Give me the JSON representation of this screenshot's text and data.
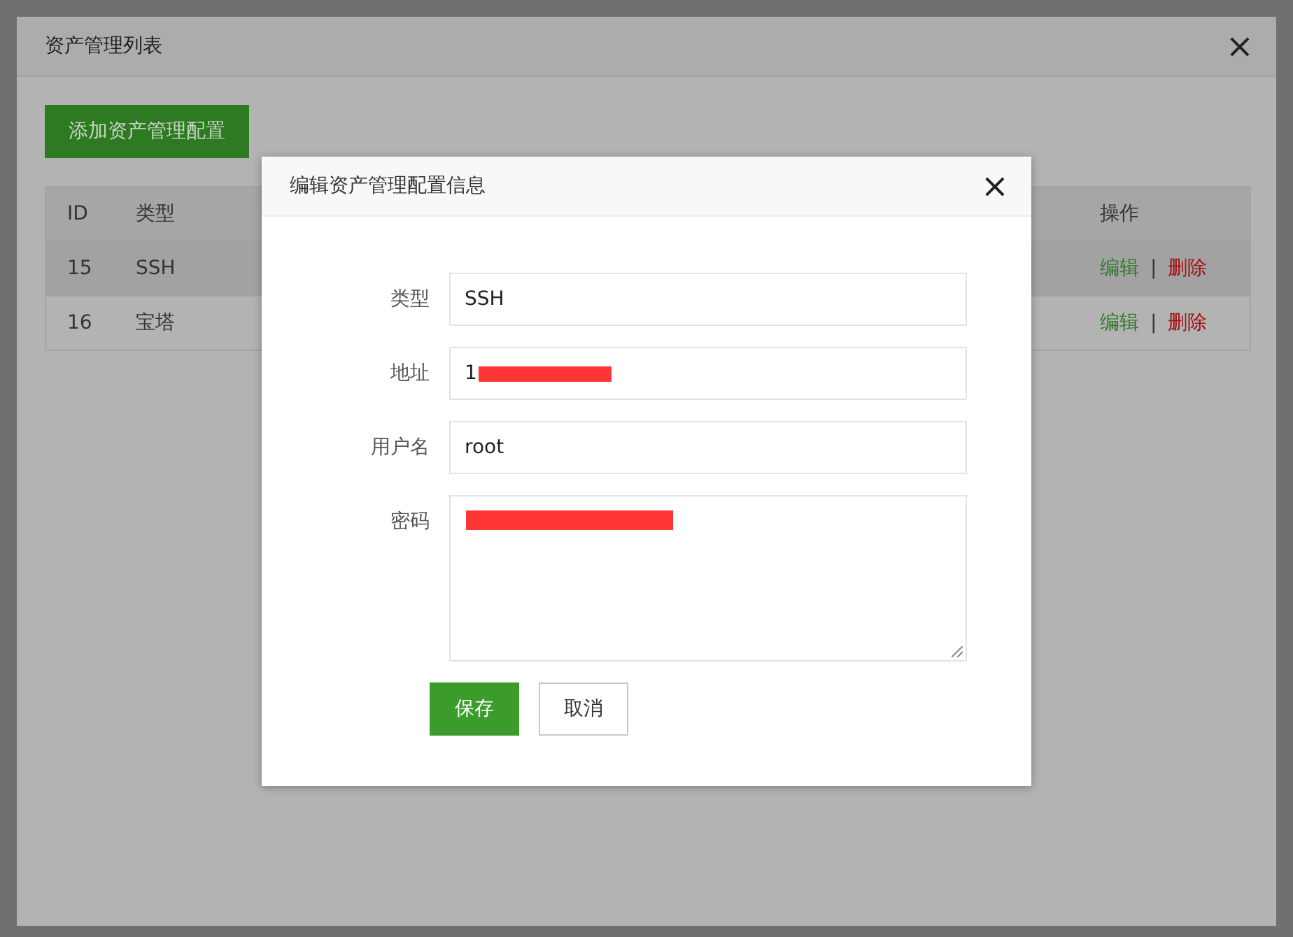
{
  "window": {
    "title": "资产管理列表",
    "close": "×"
  },
  "add_button": "添加资产管理配置",
  "table": {
    "columns": [
      "ID",
      "类型",
      "操作"
    ],
    "rows": [
      {
        "cells": [
          "15",
          "SSH"
        ],
        "highlighted": true,
        "actions": [
          "编辑",
          "|",
          "删除"
        ]
      },
      {
        "cells": [
          "16",
          "宝塔"
        ],
        "highlighted": false,
        "actions": [
          "编辑",
          "|",
          "删除"
        ]
      }
    ]
  },
  "dialog": {
    "title": "编辑资产管理配置信息",
    "close": "×",
    "fields": [
      {
        "kind": "input",
        "label": "类型",
        "value": "SSH",
        "redacted": false
      },
      {
        "kind": "input",
        "label": "地址",
        "value": "1",
        "redacted": true
      },
      {
        "kind": "input",
        "label": "用户名",
        "value": "root",
        "redacted": false
      },
      {
        "kind": "textarea",
        "label": "密码",
        "redacted": true
      }
    ],
    "buttons": [
      {
        "kind": "primary",
        "label": "保存"
      },
      {
        "kind": "default",
        "label": "取消"
      }
    ]
  }
}
